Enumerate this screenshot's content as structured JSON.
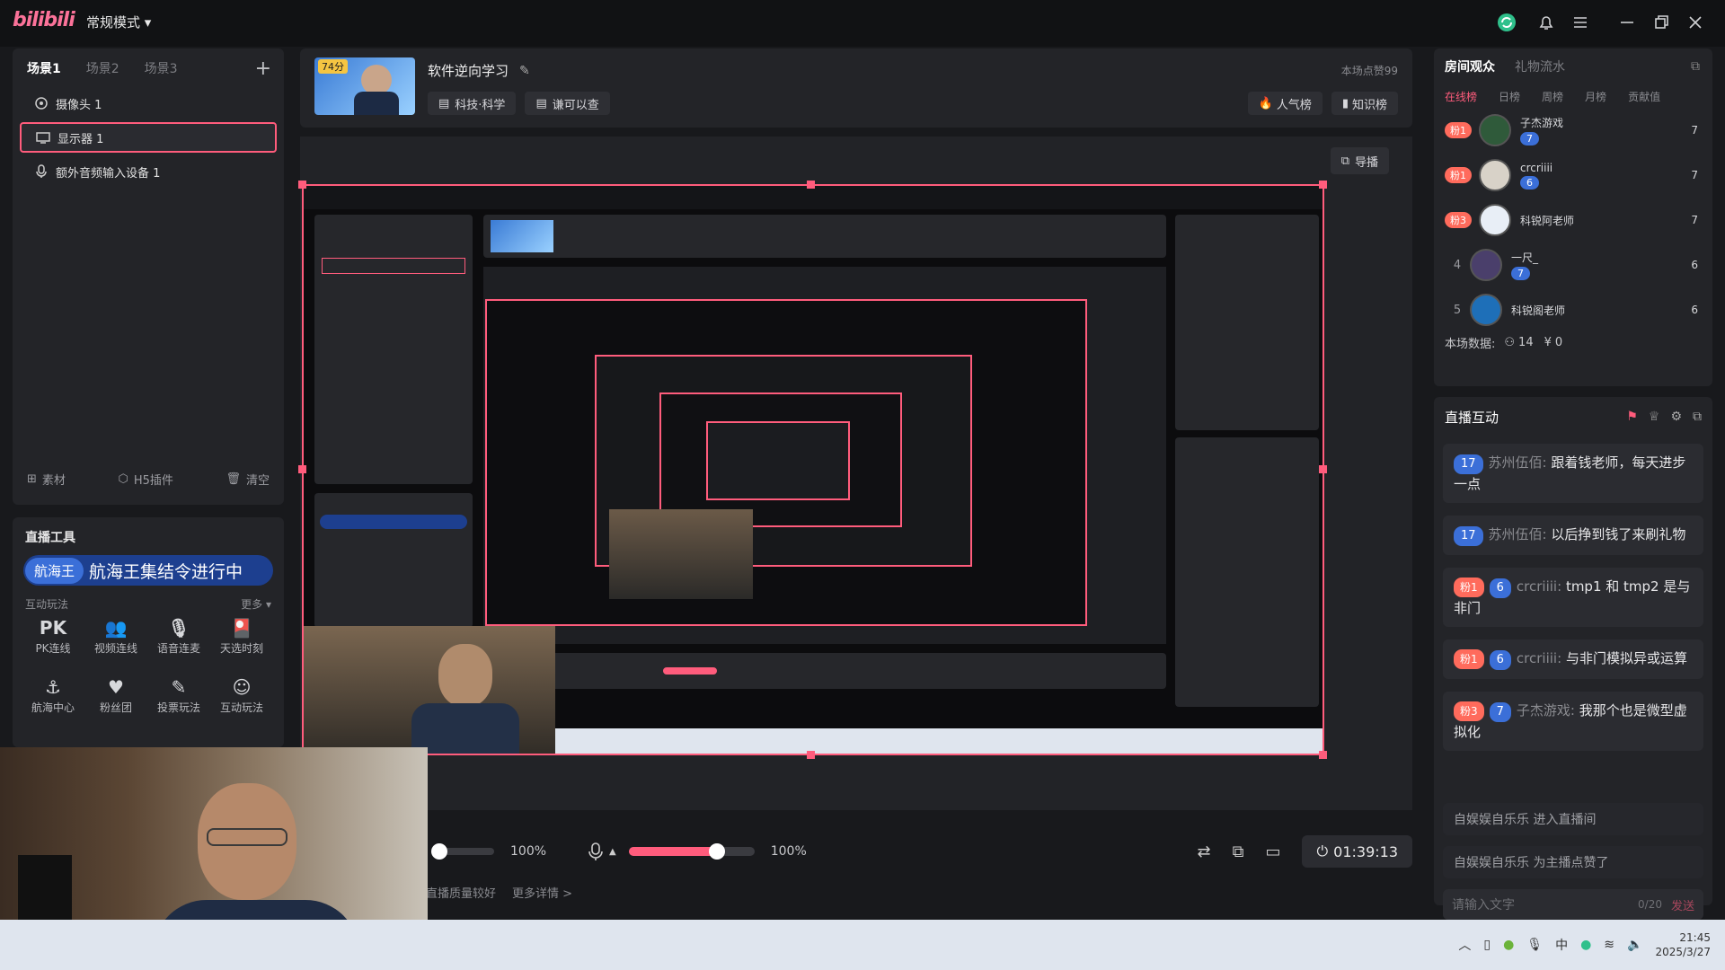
{
  "app": {
    "mode_label": "常规模式 ▾"
  },
  "scenes": {
    "tabs": [
      "场景1",
      "场景2",
      "场景3"
    ],
    "sources": [
      {
        "label": "摄像头 1",
        "icon": "camera-icon"
      },
      {
        "label": "显示器 1",
        "icon": "monitor-icon"
      },
      {
        "label": "额外音频输入设备 1",
        "icon": "microphone-icon"
      }
    ],
    "footer": {
      "material": "素材",
      "h5": "H5插件",
      "clear": "清空"
    }
  },
  "tools": {
    "title": "直播工具",
    "banner_badge": "航海王",
    "banner_text": "航海王集结令进行中",
    "section": "互动玩法",
    "more": "更多 ▾",
    "items": [
      {
        "label": "PK连线",
        "icon": "pk-icon"
      },
      {
        "label": "视频连线",
        "icon": "video-link-icon"
      },
      {
        "label": "语音连麦",
        "icon": "mic-link-icon"
      },
      {
        "label": "天选时刻",
        "icon": "lucky-draw-icon"
      },
      {
        "label": "航海中心",
        "icon": "anchor-icon"
      },
      {
        "label": "粉丝团",
        "icon": "fan-club-icon"
      },
      {
        "label": "投票玩法",
        "icon": "vote-icon"
      },
      {
        "label": "互动玩法",
        "icon": "interact-icon"
      }
    ]
  },
  "room": {
    "cover_badge": "74分",
    "title": "软件逆向学习",
    "category": "科技·科学",
    "tag": "谦可以查",
    "stat": "本场点赞99",
    "popularity": "人气榜",
    "knowledge": "知识榜",
    "guide": "导播"
  },
  "controls": {
    "volume1": "100%",
    "volume2": "100%",
    "mic_level": 0.7,
    "timer": "01:39:13",
    "status": "直播质量较好",
    "more": "更多详情 >"
  },
  "audience": {
    "tabs": [
      "房间观众",
      "礼物流水"
    ],
    "subtabs": [
      "在线榜",
      "日榜",
      "周榜",
      "月榜",
      "贡献值"
    ],
    "rows": [
      {
        "badge": "粉1",
        "name": "子杰游戏",
        "level": "7",
        "score": "7"
      },
      {
        "badge": "粉1",
        "name": "crcriiii",
        "level": "6",
        "score": "7"
      },
      {
        "badge": "粉3",
        "name": "科锐阿老师",
        "level": "",
        "score": "7"
      },
      {
        "badge": "4",
        "name": "一尺_",
        "level": "7",
        "score": "6"
      },
      {
        "badge": "5",
        "name": "科锐阁老师",
        "level": "",
        "score": "6"
      }
    ],
    "stats_label": "本场数据:",
    "viewers": "14",
    "gold": "0"
  },
  "interact": {
    "title": "直播互动",
    "messages": [
      {
        "level": "17",
        "fan": "",
        "name": "苏州伍佰:",
        "text": "跟着钱老师，每天进步一点"
      },
      {
        "level": "17",
        "fan": "",
        "name": "苏州伍佰:",
        "text": "以后挣到钱了来刷礼物"
      },
      {
        "level": "6",
        "fan": "粉1",
        "name": "crcriiii:",
        "text": "tmp1 和 tmp2 是与非门"
      },
      {
        "level": "6",
        "fan": "粉1",
        "name": "crcriiii:",
        "text": "与非门模拟异或运算"
      },
      {
        "level": "7",
        "fan": "粉3",
        "name": "子杰游戏:",
        "text": "我那个也是微型虚拟化"
      }
    ],
    "system": [
      "自娱娱自乐乐 进入直播间",
      "自娱娱自乐乐 为主播点赞了"
    ],
    "input_placeholder": "请输入文字",
    "counter": "0/20",
    "send": "发送"
  },
  "taskbar": {
    "ime": "中",
    "time": "21:45",
    "date": "2025/3/27"
  },
  "colors": {
    "accent": "#ff5c7c",
    "level_blue": "#3b6fd8",
    "fan_orange": "#ff6b5c"
  }
}
